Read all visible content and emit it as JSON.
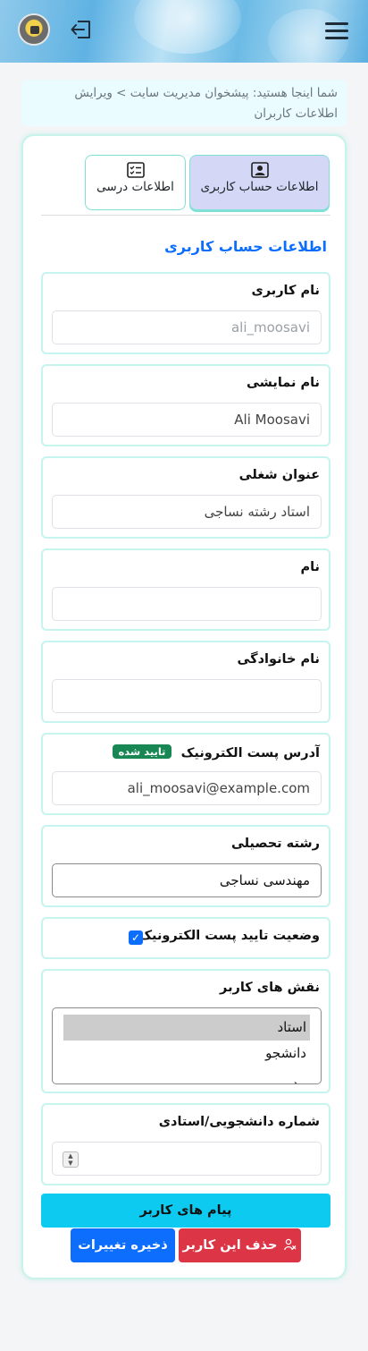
{
  "header": {
    "avatar_icon": "user-avatar-icon",
    "logout_icon": "logout-icon",
    "menu_icon": "hamburger-menu-icon"
  },
  "breadcrumb": {
    "text": "شما اینجا هستید: پیشخوان مدیریت سایت > ویرایش اطلاعات کاربران"
  },
  "tabs": [
    {
      "label": "اطلاعات حساب کاربری",
      "icon": "id-card-icon",
      "active": true
    },
    {
      "label": "اطلاعات درسی",
      "icon": "checklist-icon",
      "active": false
    }
  ],
  "section_title": "اطلاعات حساب کاربری",
  "fields": {
    "username": {
      "label": "نام کاربری",
      "placeholder": "ali_moosavi"
    },
    "display_name": {
      "label": "نام نمایشی",
      "value": "Ali Moosavi"
    },
    "job_title": {
      "label": "عنوان شغلی",
      "value": "استاد رشته نساجی"
    },
    "first_name": {
      "label": "نام",
      "value": ""
    },
    "last_name": {
      "label": "نام خانوادگی",
      "value": ""
    },
    "email": {
      "label": "آدرس پست الکترونیک",
      "badge": "تایید شده",
      "value": "ali_moosavi@example.com"
    },
    "field_of_study": {
      "label": "رشته تحصیلی",
      "value": "مهندسی نساجی"
    },
    "email_verified": {
      "label": "وضعیت تایید پست الکترونیک",
      "checked": true
    },
    "roles": {
      "label": "نقش های کاربر",
      "options": [
        "استاد",
        "دانشجو",
        "مدیر"
      ],
      "selected": "استاد"
    },
    "student_id": {
      "label": "شماره دانشجویی/استادی",
      "value": ""
    }
  },
  "buttons": {
    "messages": "پیام های کاربر",
    "delete": "حذف این کاربر",
    "save": "ذخیره تغییرات"
  },
  "colors": {
    "primary": "#0d6efd",
    "danger": "#dc3545",
    "info": "#0dcaf0",
    "success": "#198754"
  }
}
